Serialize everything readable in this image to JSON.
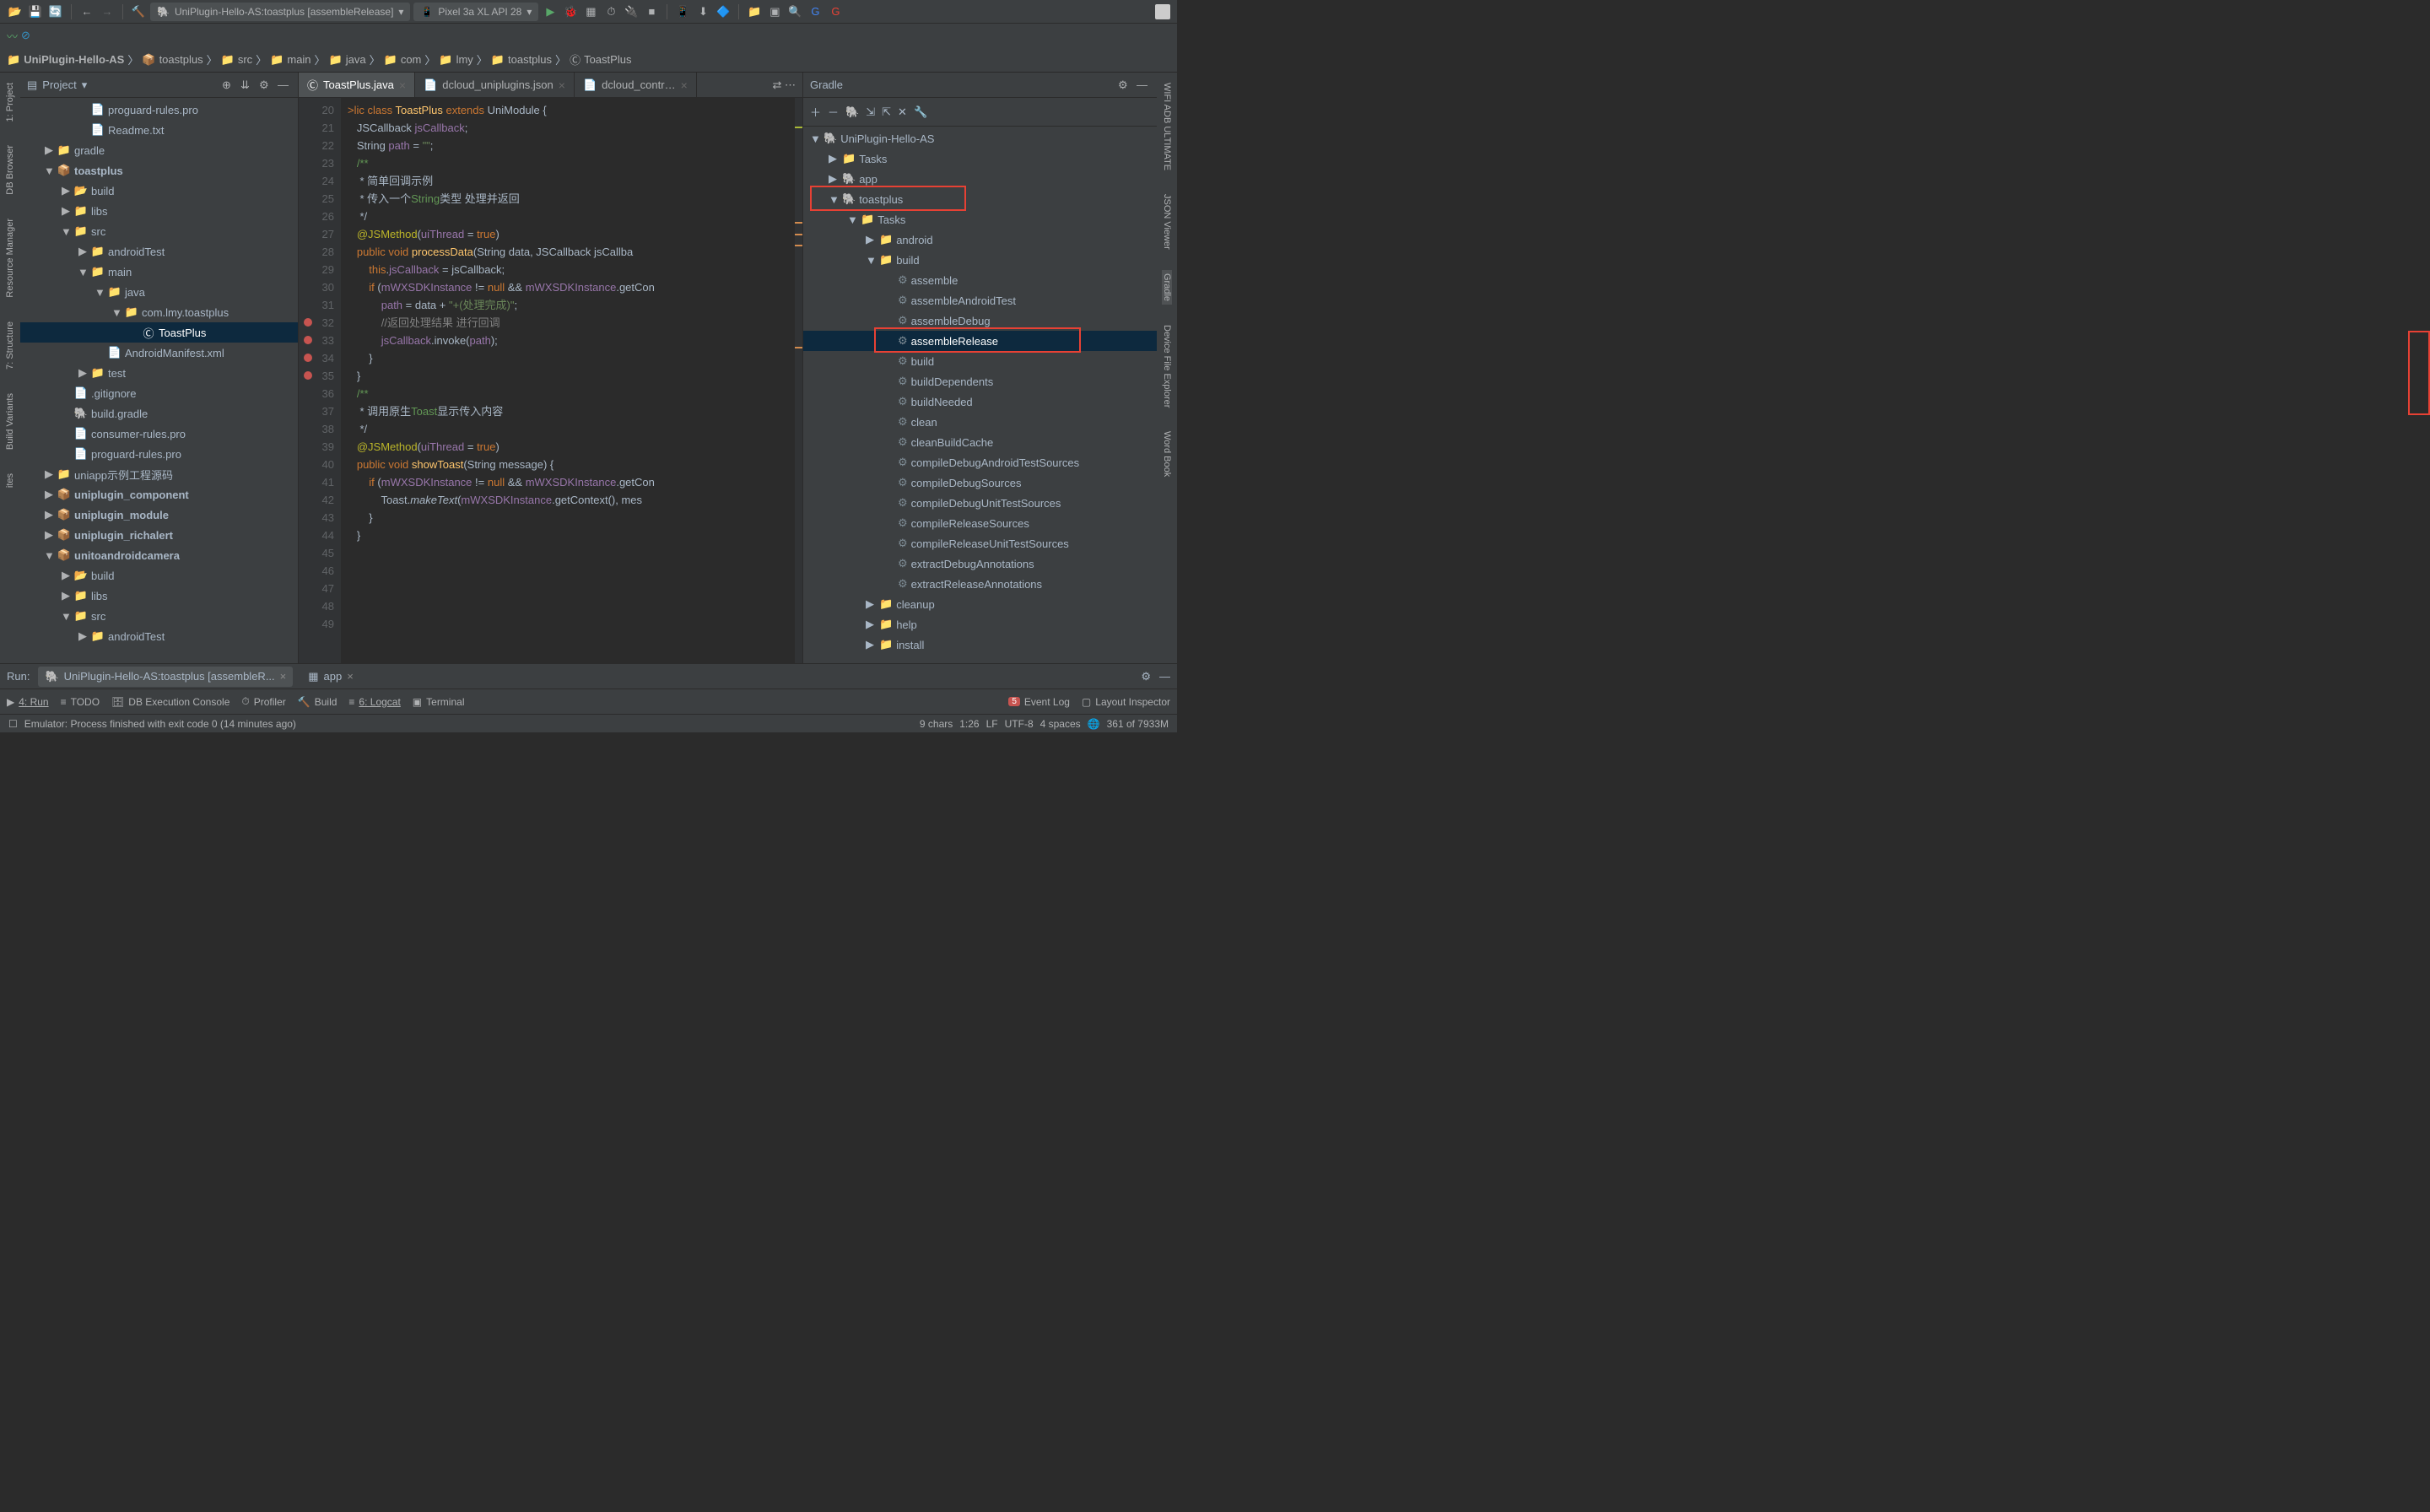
{
  "toolbar": {
    "run_config": "UniPlugin-Hello-AS:toastplus [assembleRelease]",
    "device": "Pixel 3a XL API 28"
  },
  "breadcrumb": [
    "UniPlugin-Hello-AS",
    "toastplus",
    "src",
    "main",
    "java",
    "com",
    "lmy",
    "toastplus",
    "ToastPlus"
  ],
  "project_title": "Project",
  "project_tree": [
    {
      "d": 3,
      "a": "",
      "i": "file",
      "t": "proguard-rules.pro"
    },
    {
      "d": 3,
      "a": "",
      "i": "file",
      "t": "Readme.txt"
    },
    {
      "d": 1,
      "a": "▶",
      "i": "folder",
      "t": "gradle"
    },
    {
      "d": 1,
      "a": "▼",
      "i": "mod",
      "t": "toastplus",
      "bold": true
    },
    {
      "d": 2,
      "a": "▶",
      "i": "folder-o",
      "t": "build"
    },
    {
      "d": 2,
      "a": "▶",
      "i": "folder",
      "t": "libs"
    },
    {
      "d": 2,
      "a": "▼",
      "i": "folder",
      "t": "src"
    },
    {
      "d": 3,
      "a": "▶",
      "i": "folder",
      "t": "androidTest"
    },
    {
      "d": 3,
      "a": "▼",
      "i": "folder",
      "t": "main"
    },
    {
      "d": 4,
      "a": "▼",
      "i": "folder-b",
      "t": "java"
    },
    {
      "d": 5,
      "a": "▼",
      "i": "folder",
      "t": "com.lmy.toastplus"
    },
    {
      "d": 6,
      "a": "",
      "i": "class",
      "t": "ToastPlus",
      "sel": true
    },
    {
      "d": 4,
      "a": "",
      "i": "file",
      "t": "AndroidManifest.xml"
    },
    {
      "d": 3,
      "a": "▶",
      "i": "folder",
      "t": "test"
    },
    {
      "d": 2,
      "a": "",
      "i": "file",
      "t": ".gitignore"
    },
    {
      "d": 2,
      "a": "",
      "i": "gradle",
      "t": "build.gradle"
    },
    {
      "d": 2,
      "a": "",
      "i": "file",
      "t": "consumer-rules.pro"
    },
    {
      "d": 2,
      "a": "",
      "i": "file",
      "t": "proguard-rules.pro"
    },
    {
      "d": 1,
      "a": "▶",
      "i": "folder",
      "t": "uniapp示例工程源码"
    },
    {
      "d": 1,
      "a": "▶",
      "i": "mod",
      "t": "uniplugin_component",
      "bold": true
    },
    {
      "d": 1,
      "a": "▶",
      "i": "mod",
      "t": "uniplugin_module",
      "bold": true
    },
    {
      "d": 1,
      "a": "▶",
      "i": "mod",
      "t": "uniplugin_richalert",
      "bold": true
    },
    {
      "d": 1,
      "a": "▼",
      "i": "mod",
      "t": "unitoandroidcamera",
      "bold": true
    },
    {
      "d": 2,
      "a": "▶",
      "i": "folder-o",
      "t": "build"
    },
    {
      "d": 2,
      "a": "▶",
      "i": "folder",
      "t": "libs"
    },
    {
      "d": 2,
      "a": "▼",
      "i": "folder",
      "t": "src"
    },
    {
      "d": 3,
      "a": "▶",
      "i": "folder",
      "t": "androidTest"
    }
  ],
  "editor_tabs": [
    {
      "name": "ToastPlus.java",
      "active": true,
      "icon": "class"
    },
    {
      "name": "dcloud_uniplugins.json",
      "active": false,
      "icon": "file"
    },
    {
      "name": "dcloud_contr…",
      "active": false,
      "icon": "file"
    }
  ],
  "gutter": {
    "start": 20,
    "end": 49,
    "breakpoints": [
      32,
      33,
      34,
      35
    ]
  },
  "code_lines": [
    "<span class='k-orange'>&gt;lic class </span><span class='k-yellow'>ToastPlus</span> <span class='k-orange'>extends</span> UniModule {",
    "   JSCallback <span class='k-purple'>jsCallback</span>;",
    "   String <span class='k-purple'>path</span> = <span class='k-green'>\"\"</span>;",
    "",
    "   <span class='k-doc'>/**",
    "    * 简单回调示例",
    "    * 传入一个<span class='k-doc'>String</span>类型 处理并返回",
    "    */</span>",
    "   <span class='k-ann'>@JSMethod</span>(<span class='k-purple'>uiThread</span> = <span class='k-orange'>true</span>)",
    "   <span class='k-orange'>public void </span><span class='k-yellow'>processData</span>(String data, JSCallback jsCallba",
    "       <span class='k-orange'>this</span>.<span class='k-purple'>jsCallback</span> = jsCallback;",
    "       <span class='k-orange'>if </span>(<span class='k-purple'>mWXSDKInstance</span> != <span class='k-orange'>null</span> && <span class='k-purple'>mWXSDKInstance</span>.getCon",
    "           <span class='k-purple'>path</span> = data + <span class='k-green'>\"+(处理完成)\"</span>;",
    "           <span class='k-grey'>//返回处理结果 进行回调</span>",
    "           <span class='k-purple'>jsCallback</span>.invoke(<span class='k-purple'>path</span>);",
    "       }",
    "   }",
    "",
    "   <span class='k-doc'>/**",
    "    * 调用原生<span class='k-doc'>Toast</span>显示传入内容",
    "    */</span>",
    "   <span class='k-ann'>@JSMethod</span>(<span class='k-purple'>uiThread</span> = <span class='k-orange'>true</span>)",
    "   <span class='k-orange'>public void </span><span class='k-yellow'>showToast</span>(String message) {",
    "       <span class='k-orange'>if </span>(<span class='k-purple'>mWXSDKInstance</span> != <span class='k-orange'>null</span> && <span class='k-purple'>mWXSDKInstance</span>.getCon",
    "           Toast.<span style='font-style:italic'>makeText</span>(<span class='k-purple'>mWXSDKInstance</span>.getContext(), mes",
    "       }",
    "   }",
    "",
    ""
  ],
  "gradle_title": "Gradle",
  "gradle_tree": [
    {
      "d": 0,
      "a": "▼",
      "i": "gradle",
      "t": "UniPlugin-Hello-AS"
    },
    {
      "d": 1,
      "a": "▶",
      "i": "tasks",
      "t": "Tasks"
    },
    {
      "d": 1,
      "a": "▶",
      "i": "gradle",
      "t": "app"
    },
    {
      "d": 1,
      "a": "▼",
      "i": "gradle",
      "t": "toastplus",
      "hl": 1
    },
    {
      "d": 2,
      "a": "▼",
      "i": "tasks",
      "t": "Tasks"
    },
    {
      "d": 3,
      "a": "▶",
      "i": "tasks",
      "t": "android"
    },
    {
      "d": 3,
      "a": "▼",
      "i": "tasks",
      "t": "build"
    },
    {
      "d": 4,
      "a": "",
      "i": "gear",
      "t": "assemble"
    },
    {
      "d": 4,
      "a": "",
      "i": "gear",
      "t": "assembleAndroidTest"
    },
    {
      "d": 4,
      "a": "",
      "i": "gear",
      "t": "assembleDebug"
    },
    {
      "d": 4,
      "a": "",
      "i": "gear",
      "t": "assembleRelease",
      "sel": true,
      "hl": 2
    },
    {
      "d": 4,
      "a": "",
      "i": "gear",
      "t": "build"
    },
    {
      "d": 4,
      "a": "",
      "i": "gear",
      "t": "buildDependents"
    },
    {
      "d": 4,
      "a": "",
      "i": "gear",
      "t": "buildNeeded"
    },
    {
      "d": 4,
      "a": "",
      "i": "gear",
      "t": "clean"
    },
    {
      "d": 4,
      "a": "",
      "i": "gear",
      "t": "cleanBuildCache"
    },
    {
      "d": 4,
      "a": "",
      "i": "gear",
      "t": "compileDebugAndroidTestSources"
    },
    {
      "d": 4,
      "a": "",
      "i": "gear",
      "t": "compileDebugSources"
    },
    {
      "d": 4,
      "a": "",
      "i": "gear",
      "t": "compileDebugUnitTestSources"
    },
    {
      "d": 4,
      "a": "",
      "i": "gear",
      "t": "compileReleaseSources"
    },
    {
      "d": 4,
      "a": "",
      "i": "gear",
      "t": "compileReleaseUnitTestSources"
    },
    {
      "d": 4,
      "a": "",
      "i": "gear",
      "t": "extractDebugAnnotations"
    },
    {
      "d": 4,
      "a": "",
      "i": "gear",
      "t": "extractReleaseAnnotations"
    },
    {
      "d": 3,
      "a": "▶",
      "i": "tasks",
      "t": "cleanup"
    },
    {
      "d": 3,
      "a": "▶",
      "i": "tasks",
      "t": "help"
    },
    {
      "d": 3,
      "a": "▶",
      "i": "tasks",
      "t": "install"
    }
  ],
  "run_label": "Run:",
  "run_tabs": [
    {
      "t": "UniPlugin-Hello-AS:toastplus [assembleR...",
      "i": "gradle",
      "close": true
    },
    {
      "t": "app",
      "i": "app",
      "close": true
    }
  ],
  "bottom": {
    "run": "4: Run",
    "todo": "TODO",
    "db": "DB Execution Console",
    "profiler": "Profiler",
    "build": "Build",
    "logcat": "6: Logcat",
    "terminal": "Terminal",
    "eventlog": "Event Log",
    "layout": "Layout Inspector"
  },
  "status": {
    "msg": "Emulator: Process finished with exit code 0 (14 minutes ago)",
    "chars": "9 chars",
    "pos": "1:26",
    "lf": "LF",
    "enc": "UTF-8",
    "indent": "4 spaces",
    "mem": "361 of 7933M"
  },
  "left_rail": [
    "1: Project",
    "DB Browser",
    "Resource Manager",
    "7: Structure",
    "Build Variants",
    "ites"
  ],
  "right_rail": [
    "WIFI ADB ULTIMATE",
    "JSON Viewer",
    "Gradle",
    "Device File Explorer",
    "Word Book"
  ]
}
